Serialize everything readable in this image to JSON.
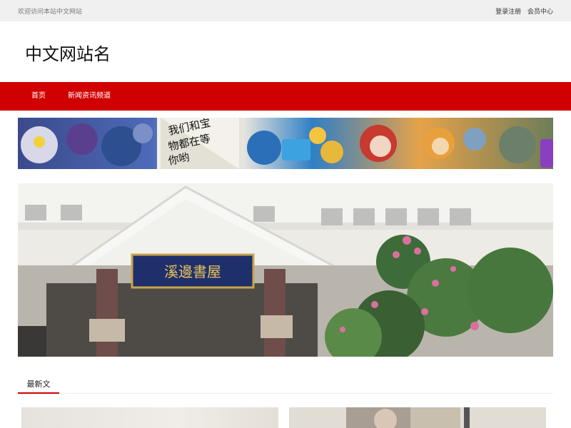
{
  "topbar": {
    "tagline": "欢迎访问本站中文网站",
    "links": [
      "登录注册",
      "会员中心"
    ]
  },
  "header": {
    "site_name": "中文网站名"
  },
  "nav": {
    "items": [
      "首页",
      "新闻资讯频道"
    ]
  },
  "ad": {
    "caption": "我们和宝物都在等你哟"
  },
  "hero": {
    "sign_text": "溪邊書屋"
  },
  "section": {
    "title": "最新文"
  },
  "colors": {
    "nav_bg": "#d10000",
    "topbar_bg": "#f0f0f0",
    "accent": "#d10000"
  }
}
